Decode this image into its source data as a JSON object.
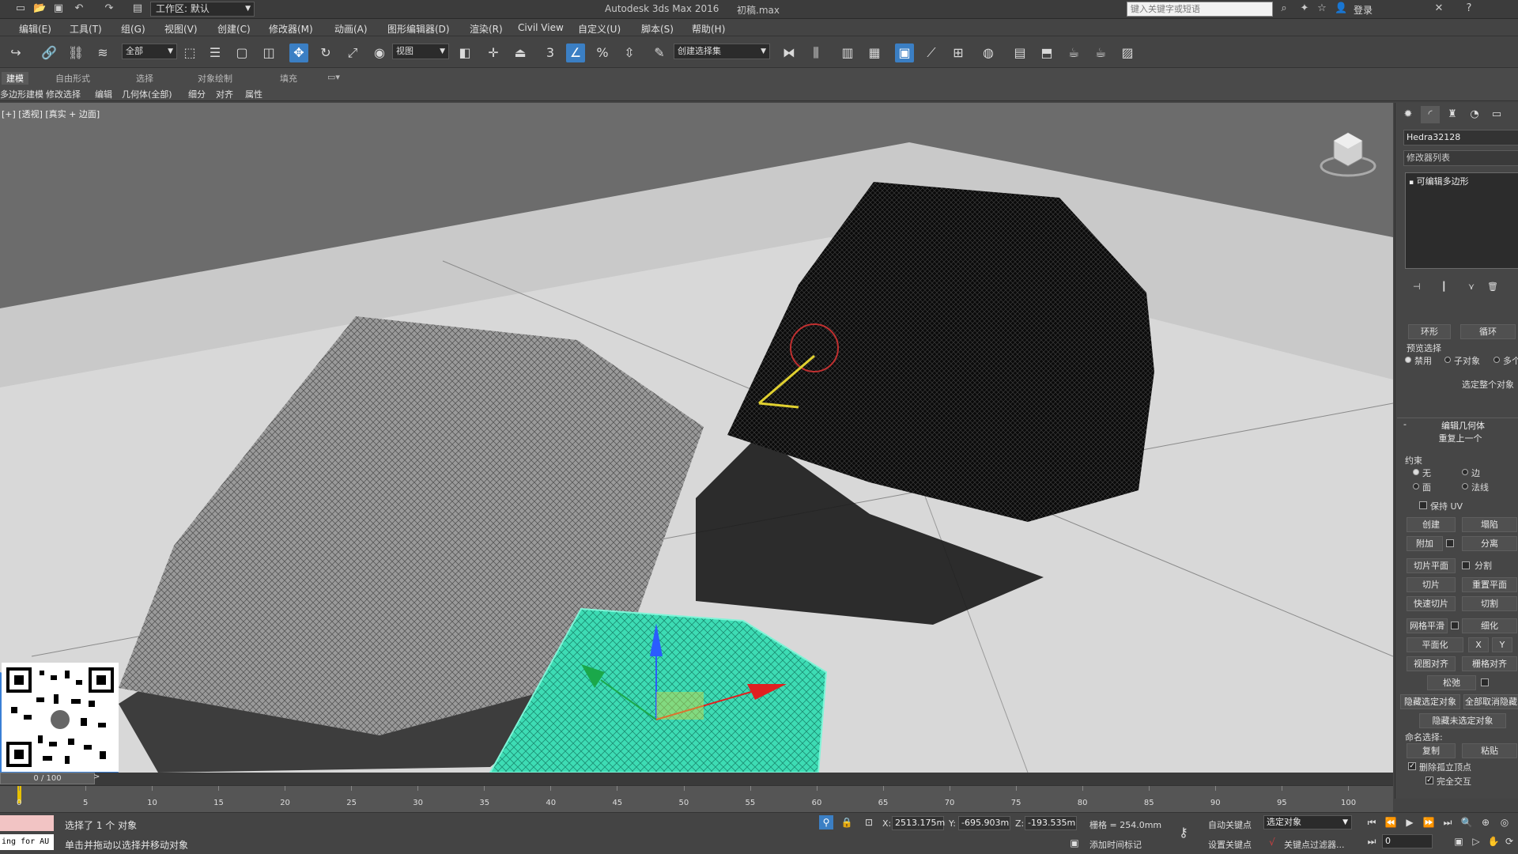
{
  "window": {
    "app_title": "Autodesk 3ds Max 2016",
    "file_title": "初稿.max",
    "workspace": "工作区: 默认",
    "help_search_placeholder": "键入关键字或短语",
    "login": "登录"
  },
  "menu": [
    "编辑(E)",
    "工具(T)",
    "组(G)",
    "视图(V)",
    "创建(C)",
    "修改器(M)",
    "动画(A)",
    "图形编辑器(D)",
    "渲染(R)",
    "Civil View",
    "自定义(U)",
    "脚本(S)",
    "帮助(H)"
  ],
  "toolbar": {
    "selection_filter": "全部",
    "ref_coord": "视图",
    "named_selection": "创建选择集"
  },
  "ribbon": {
    "tabs": [
      "建模",
      "自由形式",
      "选择",
      "对象绘制",
      "填充"
    ],
    "subtabs": [
      "多边形建模",
      "修改选择",
      "编辑",
      "几何体(全部)",
      "细分",
      "对齐",
      "属性"
    ]
  },
  "viewport": {
    "label": "[+] [透视] [真实 + 边面]"
  },
  "command_panel": {
    "object_name": "Hedra32128",
    "modifier_list": "修改器列表",
    "stack_item": "可编辑多边形",
    "ring_label": "环形",
    "loop_label": "循环",
    "preview_selection": "预览选择",
    "preview_options": [
      "禁用",
      "子对象",
      "多个"
    ],
    "select_whole": "选定整个对象",
    "edit_geometry": "编辑几何体",
    "repeat_last": "重复上一个",
    "constraints": "约束",
    "constraint_options": [
      "无",
      "边",
      "面",
      "法线"
    ],
    "preserve_uv": "保持 UV",
    "create": "创建",
    "collapse": "塌陷",
    "attach": "附加",
    "detach": "分离",
    "slice_plane": "切片平面",
    "split": "分割",
    "slice": "切片",
    "reset_plane": "重置平面",
    "quickslice": "快速切片",
    "cut": "切割",
    "meshsmooth": "网格平滑",
    "tessellate": "细化",
    "make_planar": "平面化",
    "x": "X",
    "y": "Y",
    "view_align": "视图对齐",
    "grid_align": "栅格对齐",
    "relax": "松弛",
    "hide_selected": "隐藏选定对象",
    "unhide_all": "全部取消隐藏",
    "hide_unselected": "隐藏未选定对象",
    "named_selections": "命名选择:",
    "copy": "复制",
    "paste": "粘贴",
    "delete_isolated": "删除孤立顶点",
    "full_interactivity": "完全交互"
  },
  "timeline": {
    "slider_label": "0 / 100",
    "ticks": [
      "0",
      "5",
      "10",
      "15",
      "20",
      "25",
      "30",
      "35",
      "40",
      "45",
      "50",
      "55",
      "60",
      "65",
      "70",
      "75",
      "80",
      "85",
      "90",
      "95",
      "100"
    ]
  },
  "status": {
    "selected": "选择了 1 个 对象",
    "prompt": "单击并拖动以选择并移动对象",
    "maxscript": "ing for AU",
    "x_label": "X:",
    "x_value": "2513.175m",
    "y_label": "Y:",
    "y_value": "-695.903m",
    "z_label": "Z:",
    "z_value": "-193.535m",
    "grid": "栅格 = 254.0mm",
    "add_time_tag": "添加时间标记",
    "auto_key": "自动关键点",
    "set_key": "设置关键点",
    "key_mode": "选定对象",
    "key_filters": "关键点过滤器...",
    "frame": "0"
  },
  "colors": {
    "accent": "#3b7fc4",
    "selected_object": "#40e0b8"
  }
}
